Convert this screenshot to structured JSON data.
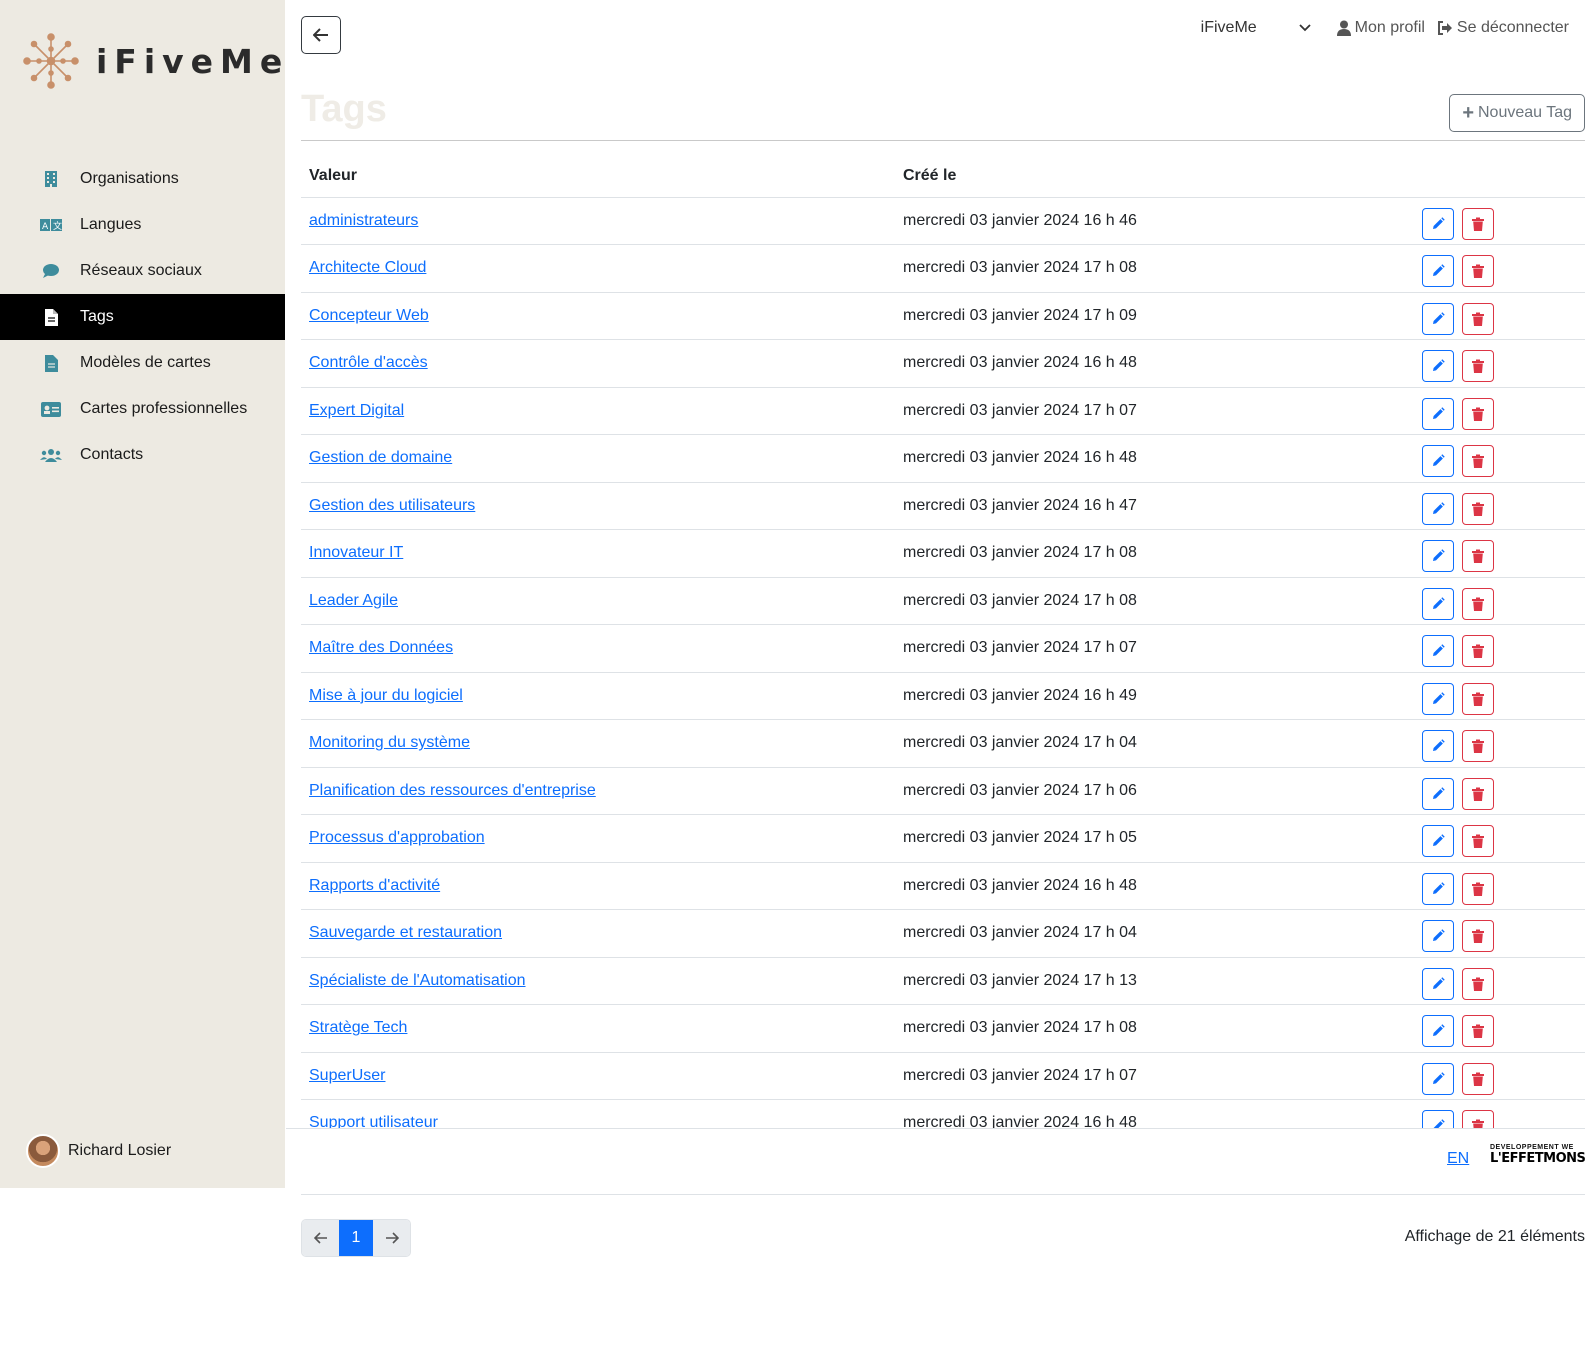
{
  "brand": {
    "name": "iFiveMe",
    "accent": "#c8906a"
  },
  "sidebar": {
    "items": [
      {
        "label": "Organisations",
        "icon": "building-icon",
        "active": false
      },
      {
        "label": "Langues",
        "icon": "language-icon",
        "active": false
      },
      {
        "label": "Réseaux sociaux",
        "icon": "comment-icon",
        "active": false
      },
      {
        "label": "Tags",
        "icon": "file-icon",
        "active": true
      },
      {
        "label": "Modèles de cartes",
        "icon": "file-icon",
        "active": false
      },
      {
        "label": "Cartes professionnelles",
        "icon": "id-card-icon",
        "active": false
      },
      {
        "label": "Contacts",
        "icon": "users-icon",
        "active": false
      }
    ],
    "user": {
      "name": "Richard Losier"
    }
  },
  "topbar": {
    "org_select": "iFiveMe",
    "profile_label": "Mon profil",
    "logout_label": "Se déconnecter"
  },
  "page": {
    "title": "Tags",
    "new_button": "Nouveau Tag"
  },
  "table": {
    "headers": {
      "value": "Valeur",
      "created": "Créé le"
    },
    "rows": [
      {
        "value": "administrateurs",
        "created": "mercredi 03 janvier 2024 16 h 46"
      },
      {
        "value": "Architecte Cloud",
        "created": "mercredi 03 janvier 2024 17 h 08"
      },
      {
        "value": "Concepteur Web",
        "created": "mercredi 03 janvier 2024 17 h 09"
      },
      {
        "value": "Contrôle d'accès",
        "created": "mercredi 03 janvier 2024 16 h 48"
      },
      {
        "value": "Expert Digital",
        "created": "mercredi 03 janvier 2024 17 h 07"
      },
      {
        "value": "Gestion de domaine",
        "created": "mercredi 03 janvier 2024 16 h 48"
      },
      {
        "value": "Gestion des utilisateurs",
        "created": "mercredi 03 janvier 2024 16 h 47"
      },
      {
        "value": "Innovateur IT",
        "created": "mercredi 03 janvier 2024 17 h 08"
      },
      {
        "value": "Leader Agile",
        "created": "mercredi 03 janvier 2024 17 h 08"
      },
      {
        "value": "Maître des Données",
        "created": "mercredi 03 janvier 2024 17 h 07"
      },
      {
        "value": "Mise à jour du logiciel",
        "created": "mercredi 03 janvier 2024 16 h 49"
      },
      {
        "value": "Monitoring du système",
        "created": "mercredi 03 janvier 2024 17 h 04"
      },
      {
        "value": "Planification des ressources d'entreprise",
        "created": "mercredi 03 janvier 2024 17 h 06"
      },
      {
        "value": "Processus d'approbation",
        "created": "mercredi 03 janvier 2024 17 h 05"
      },
      {
        "value": "Rapports d'activité",
        "created": "mercredi 03 janvier 2024 16 h 48"
      },
      {
        "value": "Sauvegarde et restauration",
        "created": "mercredi 03 janvier 2024 17 h 04"
      },
      {
        "value": "Spécialiste de l'Automatisation",
        "created": "mercredi 03 janvier 2024 17 h 13"
      },
      {
        "value": "Stratège Tech",
        "created": "mercredi 03 janvier 2024 17 h 08"
      },
      {
        "value": "SuperUser",
        "created": "mercredi 03 janvier 2024 17 h 07"
      },
      {
        "value": "Support utilisateur",
        "created": "mercredi 03 janvier 2024 16 h 48"
      }
    ]
  },
  "footer": {
    "lang_link": "EN",
    "partner_small": "DÉVELOPPEMENT WE",
    "partner_big": "L'EFFETMONSTR"
  },
  "pagination": {
    "current_page": "1",
    "count_text": "Affichage de 21 éléments"
  },
  "colors": {
    "primary": "#0d6efd",
    "danger": "#dc3545",
    "sidebar_bg": "#edeae2",
    "icon_teal": "#3e8c9c"
  }
}
